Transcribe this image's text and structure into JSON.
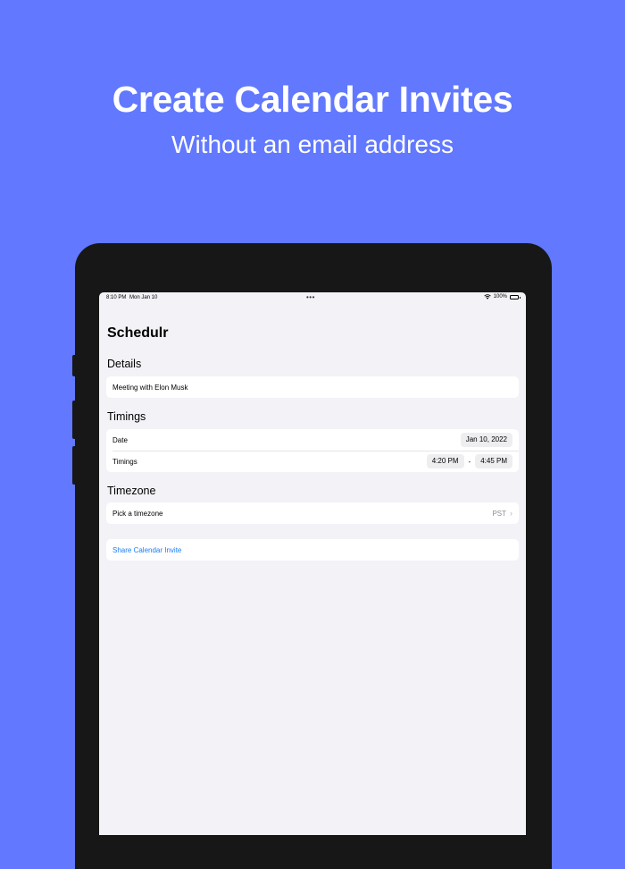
{
  "hero": {
    "title": "Create Calendar Invites",
    "subtitle": "Without an email address"
  },
  "status_bar": {
    "time": "8:10 PM",
    "date": "Mon Jan 10",
    "battery": "100%"
  },
  "app": {
    "title": "Schedulr"
  },
  "details": {
    "label": "Details",
    "event_name": "Meeting with Elon Musk"
  },
  "timings": {
    "label": "Timings",
    "date_label": "Date",
    "date_value": "Jan 10, 2022",
    "timings_label": "Timings",
    "start_time": "4:20 PM",
    "separator": "-",
    "end_time": "4:45 PM"
  },
  "timezone": {
    "label": "Timezone",
    "picker_label": "Pick a timezone",
    "picker_value": "PST"
  },
  "share": {
    "label": "Share Calendar Invite"
  },
  "colors": {
    "background": "#6178ff",
    "accent": "#1b7cf5"
  }
}
